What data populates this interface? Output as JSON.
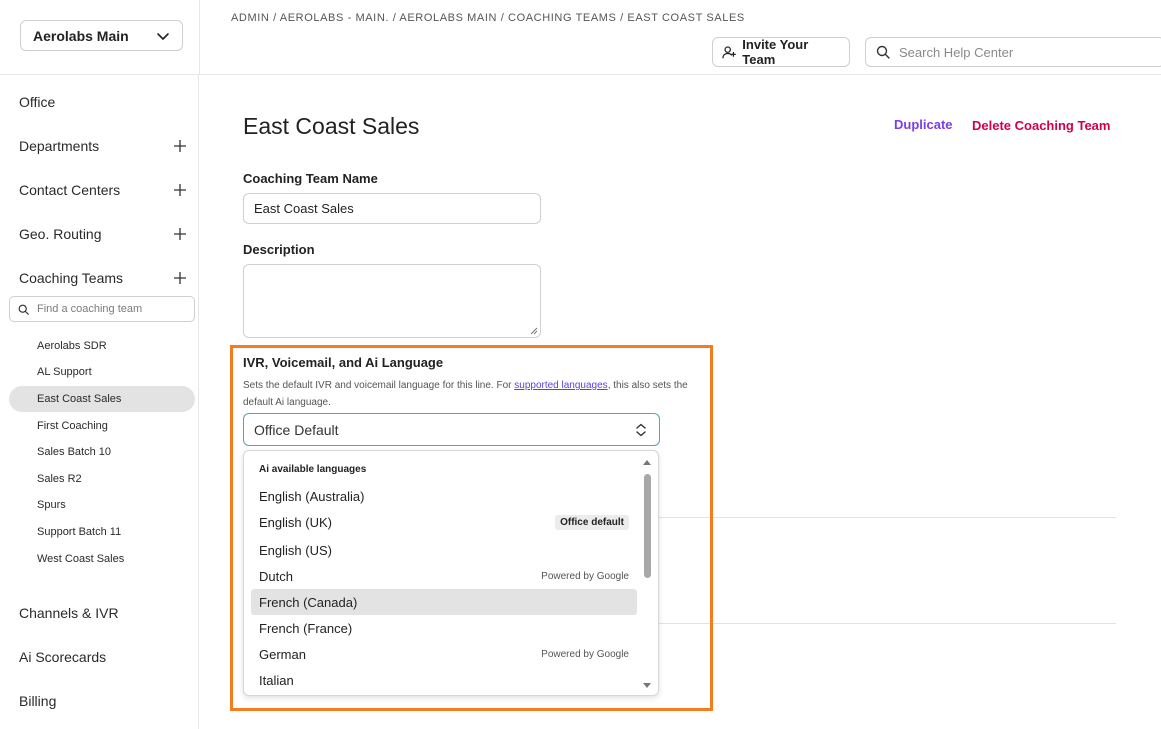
{
  "header": {
    "workspace": "Aerolabs Main",
    "breadcrumb": "ADMIN / AEROLABS - MAIN. / AEROLABS MAIN / COACHING TEAMS / EAST COAST SALES",
    "invite_label": "Invite Your Team",
    "help_search_placeholder": "Search Help Center"
  },
  "sidebar": {
    "items": [
      {
        "label": "Office"
      },
      {
        "label": "Departments"
      },
      {
        "label": "Contact Centers"
      },
      {
        "label": "Geo. Routing"
      },
      {
        "label": "Coaching Teams"
      },
      {
        "label": "Channels & IVR"
      },
      {
        "label": "Ai Scorecards"
      },
      {
        "label": "Billing"
      }
    ],
    "team_search_placeholder": "Find a coaching team",
    "teams": [
      {
        "label": "Aerolabs SDR"
      },
      {
        "label": "AL Support"
      },
      {
        "label": "East Coast Sales"
      },
      {
        "label": "First Coaching"
      },
      {
        "label": "Sales Batch 10"
      },
      {
        "label": "Sales R2"
      },
      {
        "label": "Spurs"
      },
      {
        "label": "Support Batch 11"
      },
      {
        "label": "West Coast Sales"
      }
    ]
  },
  "main": {
    "title": "East Coast Sales",
    "duplicate_label": "Duplicate",
    "delete_label": "Delete Coaching Team",
    "name_label": "Coaching Team Name",
    "name_value": "East Coast Sales",
    "description_label": "Description",
    "description_value": "",
    "language_label": "IVR, Voicemail, and Ai Language",
    "language_help_before": "Sets the default IVR and voicemail language for this line. For ",
    "language_help_link": "supported languages",
    "language_help_after": ", this also sets the default Ai language.",
    "language_value": "Office Default"
  },
  "dropdown": {
    "header": "Ai available languages",
    "options": [
      {
        "label": "English (Australia)",
        "note": ""
      },
      {
        "label": "English (UK)",
        "note": "Office default"
      },
      {
        "label": "English (US)",
        "note": ""
      },
      {
        "label": "Dutch",
        "note": "Powered by Google"
      },
      {
        "label": "French (Canada)",
        "note": ""
      },
      {
        "label": "French (France)",
        "note": ""
      },
      {
        "label": "German",
        "note": "Powered by Google"
      },
      {
        "label": "Italian",
        "note": ""
      }
    ]
  },
  "colors": {
    "accent_purple": "#7b3fe4",
    "danger": "#d1004f",
    "highlight_orange": "#f47c20",
    "focus_border": "#5aa2b8"
  }
}
